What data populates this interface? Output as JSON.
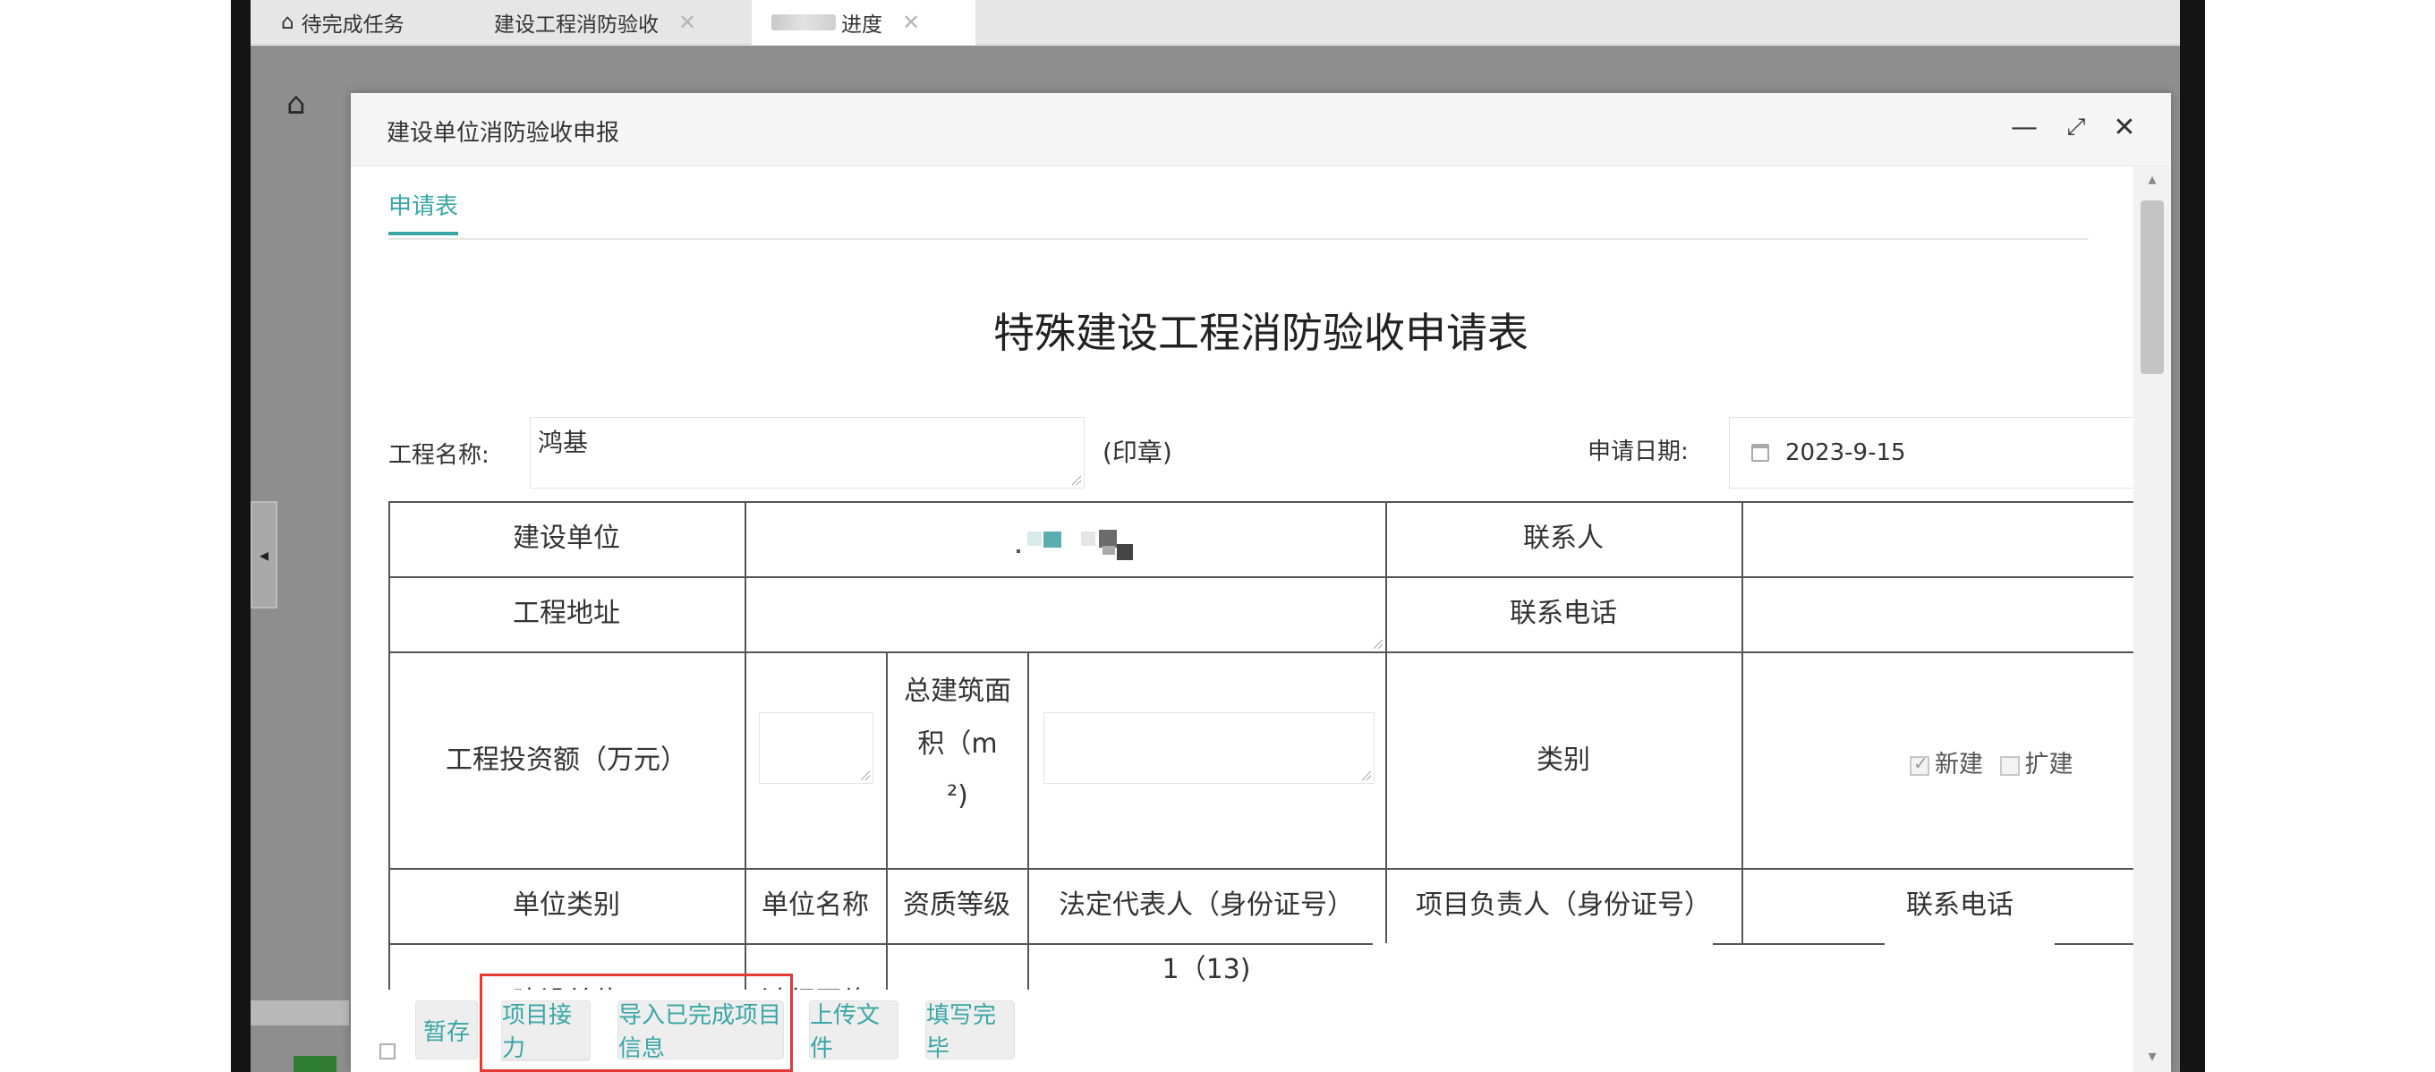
{
  "tabs": [
    {
      "label": "待完成任务",
      "icon": "home-icon"
    },
    {
      "label": "建设工程消防验收"
    },
    {
      "label": "进度",
      "blurred_prefix": true
    }
  ],
  "modal": {
    "title": "建设单位消防验收申报",
    "subtab": "申请表",
    "form_title": "特殊建设工程消防验收申请表",
    "project_name_label": "工程名称:",
    "project_name_value": "鸿基",
    "seal_label": "(印章)",
    "apply_date_label": "申请日期:",
    "apply_date_value": "2023-9-15",
    "table": {
      "r1_c1": "建设单位",
      "r1_c3": "联系人",
      "r2_c1": "工程地址",
      "r2_c3": "联系电话",
      "r3_c1": "工程投资额（万元）",
      "r3_area_line1": "总建筑面",
      "r3_area_line2": "积（m",
      "r3_area_line3": "²)",
      "r3_c3": "类别",
      "opt_new": "新建",
      "opt_expand": "扩建",
      "h_unit_type": "单位类别",
      "h_unit_name": "单位名称",
      "h_qualification": "资质等级",
      "h_legal_rep": "法定代表人（身份证号）",
      "h_project_lead": "项目负责人（身份证号）",
      "h_phone": "联系电话",
      "r5_c1": "建设单位",
      "r5_c2": "鸿行网络",
      "r5_c4": "1（13)"
    },
    "buttons": {
      "save_draft": "暂存",
      "project_handover": "项目接力",
      "import_completed": "导入已完成项目信息",
      "upload_file": "上传文件",
      "finish": "填写完毕"
    }
  },
  "colors": {
    "accent": "#3aa6a6",
    "highlight": "#e53935"
  }
}
